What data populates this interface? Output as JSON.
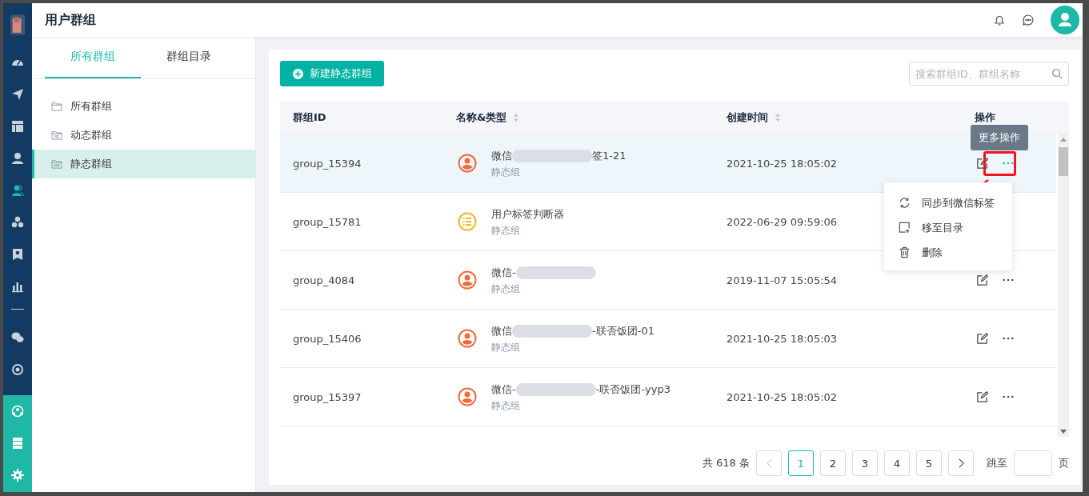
{
  "page_title": "用户群组",
  "sidebar": [
    {
      "kind": "gauge",
      "selected": false
    },
    {
      "kind": "send",
      "selected": false
    },
    {
      "kind": "layout",
      "selected": false
    },
    {
      "kind": "user",
      "selected": false
    },
    {
      "kind": "users",
      "selected": true
    },
    {
      "kind": "hexagons",
      "selected": false
    },
    {
      "kind": "badge",
      "selected": false
    },
    {
      "kind": "bars",
      "selected": false
    },
    {
      "kind": "divider"
    },
    {
      "kind": "chat",
      "selected": false
    },
    {
      "kind": "disc",
      "selected": false
    }
  ],
  "sidebar_bottom": [
    {
      "kind": "network"
    },
    {
      "kind": "server"
    },
    {
      "kind": "gear"
    }
  ],
  "tabs": [
    {
      "label": "所有群组",
      "selected": true
    },
    {
      "label": "群组目录",
      "selected": false
    }
  ],
  "folders": [
    {
      "label": "所有群组",
      "kind": "plain",
      "selected": false
    },
    {
      "label": "动态群组",
      "kind": "dynamic",
      "selected": false
    },
    {
      "label": "静态群组",
      "kind": "static",
      "selected": true
    }
  ],
  "new_button": "新建静态群组",
  "search": {
    "placeholder": "搜索群组ID、群组名称"
  },
  "columns": [
    {
      "label": "群组ID",
      "sortable": false
    },
    {
      "label": "名称&类型",
      "sortable": true
    },
    {
      "label": "创建时间",
      "sortable": true
    },
    {
      "label": "操作",
      "sortable": false
    }
  ],
  "rows": [
    {
      "id": "group_15394",
      "name_start": "微信",
      "blurred": true,
      "name_end": "签1-21",
      "type": "静态组",
      "kind": "person",
      "created": "2021-10-25 18:05:02",
      "hovered": true,
      "actions_covered": false
    },
    {
      "id": "group_15781",
      "name_start": "用户标签判断器",
      "blurred": false,
      "type": "静态组",
      "kind": "list",
      "created": "2022-06-29 09:59:06",
      "hovered": false,
      "actions_covered": true
    },
    {
      "id": "group_4084",
      "name_start": "微信-",
      "blurred": true,
      "type": "静态组",
      "kind": "person",
      "created": "2019-11-07 15:05:54",
      "hovered": false,
      "actions_covered": false
    },
    {
      "id": "group_15406",
      "name_start": "微信",
      "blurred": true,
      "name_end": "-联否饭团-01",
      "type": "静态组",
      "kind": "person",
      "created": "2021-10-25 18:05:03",
      "hovered": false,
      "actions_covered": false
    },
    {
      "id": "group_15397",
      "name_start": "微信-",
      "blurred": true,
      "name_end": "-联否饭团-yyp3",
      "type": "静态组",
      "kind": "person",
      "created": "2021-10-25 18:05:02",
      "hovered": false,
      "actions_covered": false
    }
  ],
  "tooltip": "更多操作",
  "menu": [
    {
      "kind": "sync",
      "label": "同步到微信标签"
    },
    {
      "kind": "move",
      "label": "移至目录"
    },
    {
      "kind": "delete",
      "label": "删除"
    }
  ],
  "pagination": {
    "total": "共 618 条",
    "prev_disabled": true,
    "next_disabled": false,
    "pages": [
      {
        "label": "1",
        "selected": true
      },
      {
        "label": "2",
        "selected": false
      },
      {
        "label": "3",
        "selected": false
      },
      {
        "label": "4",
        "selected": false
      },
      {
        "label": "5",
        "selected": false
      }
    ],
    "jump_label": "跳至",
    "page_suffix": "页"
  }
}
